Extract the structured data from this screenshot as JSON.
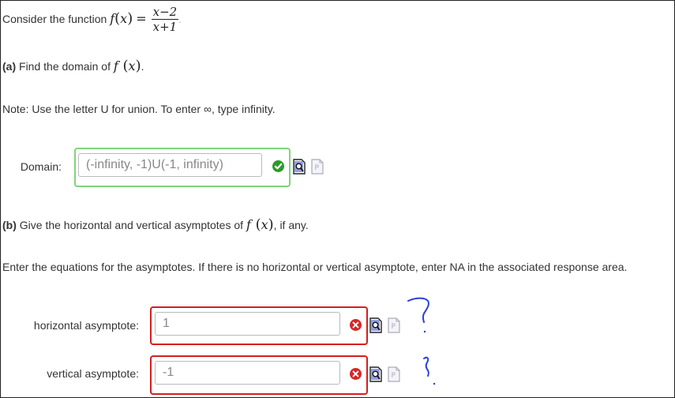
{
  "intro": {
    "text": "Consider the function",
    "func_name": "f",
    "func_var": "x",
    "equals": "=",
    "numerator": "x−2",
    "denominator": "x+1",
    "period": "."
  },
  "part_a": {
    "bold": "(a)",
    "text": "Find the domain of",
    "func_name": "f",
    "func_var": "x",
    "period": "."
  },
  "note": {
    "text": "Note: Use the letter U for union. To enter ∞, type infinity."
  },
  "domain": {
    "label": "Domain:",
    "value": "(-infinity, -1)U(-1, infinity)",
    "status": "correct"
  },
  "part_b": {
    "bold": "(b)",
    "text": "Give the horizontal and vertical asymptotes of",
    "func_name": "f",
    "func_var": "x",
    "tail": ", if any."
  },
  "instructions": {
    "text": "Enter the equations for the asymptotes. If there is no horizontal or vertical asymptote, enter NA in the associated response area."
  },
  "horizontal": {
    "label": "horizontal asymptote:",
    "value": "1",
    "status": "incorrect"
  },
  "vertical": {
    "label": "vertical asymptote:",
    "value": "-1",
    "status": "incorrect"
  },
  "colors": {
    "correct_border": "#7ed47a",
    "incorrect_border": "#d71d1d",
    "correct_icon": "#2a9a2a",
    "incorrect_icon": "#d42828",
    "annotation_ink": "#2b3fd6"
  },
  "icons": {
    "preview": "preview-magnifier-icon",
    "help": "help-page-icon",
    "correct": "checkmark-icon",
    "incorrect": "x-mark-icon"
  }
}
